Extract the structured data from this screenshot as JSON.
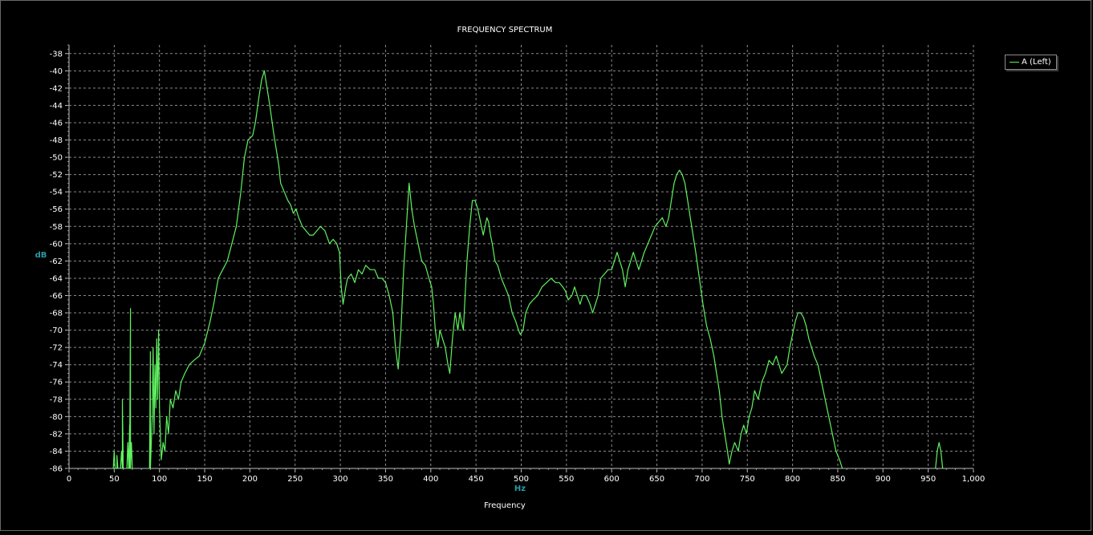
{
  "chart_data": {
    "type": "line",
    "title": "FREQUENCY SPECTRUM",
    "xlabel": "Frequency",
    "x_unit": "Hz",
    "ylabel": "dB",
    "xlim": [
      0,
      1000
    ],
    "ylim": [
      -86,
      -37
    ],
    "x_ticks": [
      0,
      50,
      100,
      150,
      200,
      250,
      300,
      350,
      400,
      450,
      500,
      550,
      600,
      650,
      700,
      750,
      800,
      850,
      900,
      950,
      1000
    ],
    "x_tick_labels": [
      "0",
      "50",
      "100",
      "150",
      "200",
      "250",
      "300",
      "350",
      "400",
      "450",
      "500",
      "550",
      "600",
      "650",
      "700",
      "750",
      "800",
      "850",
      "900",
      "950",
      "1,000"
    ],
    "y_ticks": [
      -38,
      -40,
      -42,
      -44,
      -46,
      -48,
      -50,
      -52,
      -54,
      -56,
      -58,
      -60,
      -62,
      -64,
      -66,
      -68,
      -70,
      -72,
      -74,
      -76,
      -78,
      -80,
      -82,
      -84,
      -86
    ],
    "grid": true,
    "legend_position": "top-right",
    "series": [
      {
        "name": "A (Left)",
        "color": "#5ff15f",
        "segments": [
          [
            [
              49,
              -86
            ],
            [
              50,
              -84
            ],
            [
              51,
              -86
            ],
            [
              53,
              -86
            ],
            [
              53,
              -84.5
            ],
            [
              54,
              -86
            ]
          ],
          [
            [
              57,
              -86
            ],
            [
              58,
              -84
            ],
            [
              59,
              -86
            ],
            [
              59,
              -78
            ],
            [
              60,
              -86
            ]
          ],
          [
            [
              64,
              -86
            ],
            [
              65,
              -83
            ],
            [
              66,
              -86
            ],
            [
              67,
              -81
            ],
            [
              67,
              -86
            ],
            [
              68,
              -67.5
            ],
            [
              68,
              -86
            ],
            [
              69,
              -83
            ],
            [
              70,
              -86
            ]
          ],
          [
            [
              89,
              -86
            ],
            [
              90,
              -72.5
            ],
            [
              90,
              -86
            ],
            [
              92,
              -80
            ],
            [
              93,
              -72
            ],
            [
              94,
              -82
            ],
            [
              95,
              -74
            ],
            [
              96,
              -79
            ],
            [
              97,
              -71
            ],
            [
              98,
              -78
            ],
            [
              99,
              -70
            ],
            [
              100,
              -79
            ],
            [
              102,
              -85
            ],
            [
              104,
              -83
            ],
            [
              106,
              -84
            ],
            [
              108,
              -80
            ],
            [
              110,
              -82
            ],
            [
              112,
              -78
            ],
            [
              115,
              -79
            ],
            [
              118,
              -77
            ],
            [
              121,
              -78
            ],
            [
              124,
              -76
            ],
            [
              128,
              -75
            ],
            [
              133,
              -74
            ],
            [
              138,
              -73.5
            ],
            [
              144,
              -73
            ],
            [
              150,
              -71.5
            ],
            [
              156,
              -69
            ],
            [
              160,
              -67
            ],
            [
              165,
              -64
            ],
            [
              170,
              -63
            ],
            [
              175,
              -62
            ],
            [
              180,
              -60
            ],
            [
              185,
              -58
            ],
            [
              190,
              -54
            ],
            [
              194,
              -50
            ],
            [
              198,
              -48
            ],
            [
              203,
              -47.5
            ],
            [
              206,
              -46
            ],
            [
              210,
              -43
            ],
            [
              213,
              -41
            ],
            [
              216,
              -40
            ],
            [
              219,
              -42
            ],
            [
              222,
              -44
            ],
            [
              226,
              -47
            ],
            [
              229,
              -49
            ],
            [
              232,
              -51
            ],
            [
              234,
              -53
            ],
            [
              238,
              -54
            ],
            [
              242,
              -55
            ],
            [
              245,
              -55.5
            ],
            [
              248,
              -56.5
            ],
            [
              251,
              -56
            ],
            [
              254,
              -57
            ],
            [
              258,
              -58
            ],
            [
              262,
              -58.5
            ],
            [
              266,
              -59
            ],
            [
              270,
              -59
            ],
            [
              274,
              -58.5
            ],
            [
              278,
              -58
            ],
            [
              283,
              -58.5
            ],
            [
              288,
              -60
            ],
            [
              292,
              -59.5
            ],
            [
              296,
              -60
            ],
            [
              299,
              -61
            ],
            [
              301,
              -65
            ],
            [
              303,
              -67
            ],
            [
              306,
              -65
            ],
            [
              308,
              -64
            ],
            [
              312,
              -63.5
            ],
            [
              316,
              -64.5
            ],
            [
              320,
              -63
            ],
            [
              324,
              -63.5
            ],
            [
              328,
              -62.5
            ],
            [
              333,
              -63
            ],
            [
              338,
              -63
            ],
            [
              342,
              -64
            ],
            [
              346,
              -64
            ],
            [
              350,
              -64.5
            ],
            [
              354,
              -66
            ],
            [
              358,
              -68
            ],
            [
              361,
              -72
            ],
            [
              364,
              -74.5
            ],
            [
              367,
              -70
            ],
            [
              370,
              -63
            ],
            [
              373,
              -58
            ],
            [
              376,
              -53
            ],
            [
              379,
              -56
            ],
            [
              382,
              -58
            ],
            [
              386,
              -60
            ],
            [
              390,
              -62
            ],
            [
              394,
              -62.5
            ],
            [
              398,
              -64
            ],
            [
              401,
              -65
            ],
            [
              403,
              -67
            ],
            [
              405,
              -70
            ],
            [
              408,
              -72
            ],
            [
              410,
              -70
            ],
            [
              413,
              -71
            ],
            [
              416,
              -72
            ],
            [
              419,
              -74
            ],
            [
              421,
              -75
            ],
            [
              424,
              -71
            ],
            [
              427,
              -68
            ],
            [
              430,
              -70
            ],
            [
              432,
              -68
            ],
            [
              436,
              -70
            ],
            [
              438,
              -66
            ],
            [
              440,
              -62
            ],
            [
              443,
              -58
            ],
            [
              446,
              -55
            ],
            [
              449,
              -55
            ],
            [
              452,
              -56
            ],
            [
              454,
              -57
            ],
            [
              456,
              -58
            ],
            [
              458,
              -59
            ],
            [
              460,
              -58
            ],
            [
              462,
              -57
            ],
            [
              464,
              -57.5
            ],
            [
              466,
              -59
            ],
            [
              468,
              -60
            ],
            [
              471,
              -62
            ],
            [
              474,
              -62.5
            ],
            [
              478,
              -64
            ],
            [
              482,
              -65
            ],
            [
              486,
              -66
            ],
            [
              490,
              -68
            ],
            [
              494,
              -69
            ],
            [
              497,
              -70
            ],
            [
              499,
              -70.5
            ],
            [
              502,
              -70
            ],
            [
              505,
              -68
            ],
            [
              509,
              -67
            ],
            [
              513,
              -66.5
            ],
            [
              518,
              -66
            ],
            [
              523,
              -65
            ],
            [
              528,
              -64.5
            ],
            [
              533,
              -64
            ],
            [
              538,
              -64.5
            ],
            [
              542,
              -64.5
            ],
            [
              546,
              -65
            ],
            [
              549,
              -65.5
            ],
            [
              552,
              -66.5
            ],
            [
              556,
              -66
            ],
            [
              559,
              -65
            ],
            [
              562,
              -66
            ],
            [
              565,
              -67
            ],
            [
              568,
              -66
            ],
            [
              572,
              -66
            ],
            [
              576,
              -67
            ],
            [
              579,
              -68
            ],
            [
              582,
              -67
            ],
            [
              585,
              -66
            ],
            [
              588,
              -64
            ],
            [
              592,
              -63.5
            ],
            [
              596,
              -63
            ],
            [
              600,
              -63
            ],
            [
              603,
              -62
            ],
            [
              606,
              -61
            ],
            [
              609,
              -62
            ],
            [
              612,
              -63
            ],
            [
              615,
              -65
            ],
            [
              618,
              -63
            ],
            [
              621,
              -62
            ],
            [
              624,
              -61
            ],
            [
              627,
              -62
            ],
            [
              630,
              -63
            ],
            [
              633,
              -62
            ],
            [
              636,
              -61
            ],
            [
              640,
              -60
            ],
            [
              644,
              -59
            ],
            [
              648,
              -58
            ],
            [
              652,
              -57.5
            ],
            [
              656,
              -57
            ],
            [
              660,
              -58
            ],
            [
              663,
              -57
            ],
            [
              666,
              -55
            ],
            [
              669,
              -53
            ],
            [
              672,
              -52
            ],
            [
              675,
              -51.5
            ],
            [
              678,
              -52
            ],
            [
              681,
              -53
            ],
            [
              684,
              -55
            ],
            [
              687,
              -57
            ],
            [
              690,
              -59
            ],
            [
              693,
              -61
            ],
            [
              697,
              -64
            ],
            [
              701,
              -67
            ],
            [
              705,
              -69.5
            ],
            [
              709,
              -71
            ],
            [
              713,
              -73
            ],
            [
              716,
              -75
            ],
            [
              719,
              -77
            ],
            [
              722,
              -80
            ],
            [
              725,
              -82
            ],
            [
              728,
              -84
            ],
            [
              730,
              -85.5
            ],
            [
              733,
              -84
            ],
            [
              736,
              -83
            ],
            [
              740,
              -84
            ],
            [
              743,
              -82
            ],
            [
              746,
              -81
            ],
            [
              749,
              -82
            ],
            [
              752,
              -80
            ],
            [
              755,
              -79
            ],
            [
              758,
              -77
            ],
            [
              762,
              -78
            ],
            [
              766,
              -76
            ],
            [
              770,
              -75
            ],
            [
              774,
              -73.5
            ],
            [
              778,
              -74
            ],
            [
              782,
              -73
            ],
            [
              785,
              -74
            ],
            [
              788,
              -75
            ],
            [
              791,
              -74.5
            ],
            [
              794,
              -74
            ],
            [
              797,
              -72
            ],
            [
              800,
              -70.5
            ],
            [
              803,
              -69
            ],
            [
              806,
              -68
            ],
            [
              809,
              -68
            ],
            [
              812,
              -68.5
            ],
            [
              815,
              -69.5
            ],
            [
              818,
              -71
            ],
            [
              821,
              -72
            ],
            [
              824,
              -73
            ],
            [
              828,
              -74
            ],
            [
              832,
              -76
            ],
            [
              836,
              -78
            ],
            [
              840,
              -80
            ],
            [
              844,
              -82
            ],
            [
              848,
              -84
            ],
            [
              852,
              -85
            ],
            [
              855,
              -86
            ]
          ],
          [
            [
              958,
              -86
            ],
            [
              960,
              -84
            ],
            [
              962,
              -83
            ],
            [
              964,
              -84
            ],
            [
              966,
              -86
            ]
          ]
        ]
      }
    ]
  }
}
